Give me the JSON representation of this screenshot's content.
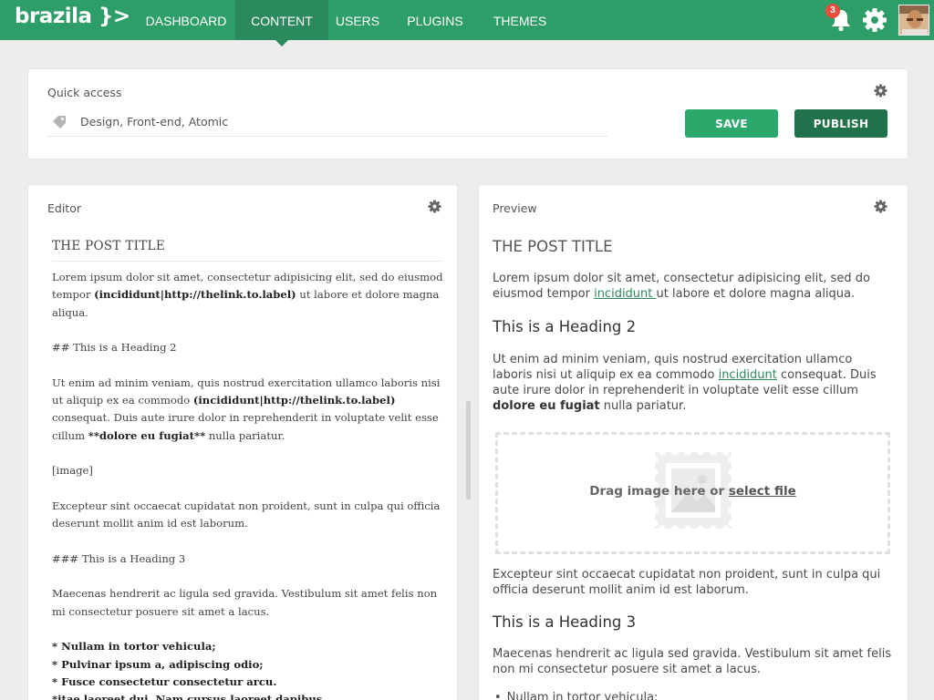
{
  "nav": {
    "logo": "brazila }>",
    "items": [
      {
        "label": "DASHBOARD"
      },
      {
        "label": "CONTENT"
      },
      {
        "label": "USERS"
      },
      {
        "label": "PLUGINS"
      },
      {
        "label": "THEMES"
      }
    ],
    "active_item": "CONTENT",
    "notifications": "3"
  },
  "quick_access": {
    "label": "Quick access",
    "tags_value": "Design, Front-end, Atomic",
    "save_label": "SAVE",
    "publish_label": "PUBLISH"
  },
  "editor": {
    "label": "Editor",
    "title": "THE POST TITLE",
    "p1_a": "Lorem ipsum dolor sit amet, consectetur adipisicing elit, sed do eiusmod tempor ",
    "p1_bold": "(incididunt|http://thelink.to.label)",
    "p1_b": " ut labore et dolore magna aliqua.",
    "h2": "## This is a Heading 2",
    "p2_a": "Ut enim ad minim veniam, quis nostrud exercitation ullamco laboris nisi ut aliquip ex ea commodo ",
    "p2_bold": "(incididunt|http://thelink.to.label)",
    "p2_b": " consequat. Duis aute irure dolor in reprehenderit in voluptate velit esse cillum ",
    "p2_bold2": "**dolore eu fugiat**",
    "p2_c": " nulla pariatur.",
    "image": "[image]",
    "p3": "Excepteur sint occaecat cupidatat non proident, sunt in culpa qui officia deserunt mollit anim id est laborum.",
    "h3": "### This is a Heading 3",
    "p4": "Maecenas hendrerit ac ligula sed gravida. Vestibulum sit amet felis non mi consectetur posuere sit amet a lacus.",
    "list": [
      "* Nullam in tortor vehicula;",
      "* Pulvinar ipsum a, adipiscing odio;",
      "* Fusce consectetur consectetur arcu.",
      "*itae laoreet dui. Nam cursus laoreet dapibus."
    ]
  },
  "preview": {
    "label": "Preview",
    "title": "THE POST TITLE",
    "p1_a": "Lorem ipsum dolor sit amet, consectetur adipisicing elit, sed do eiusmod tempor ",
    "p1_link": "incididunt ",
    "p1_b": "ut labore et dolore magna aliqua.",
    "h2": "This is a Heading 2",
    "p2_a": "Ut enim ad minim veniam, quis nostrud exercitation ullamco laboris nisi ut aliquip ex ea commodo ",
    "p2_link": "incididunt",
    "p2_b": " consequat. Duis aute irure dolor in reprehenderit in voluptate velit esse cillum ",
    "p2_bold": "dolore eu fugiat",
    "p2_c": " nulla pariatur.",
    "drop_text": "Drag image here or ",
    "drop_link": "select file",
    "p3": "Excepteur sint occaecat cupidatat non proident, sunt in culpa qui officia deserunt mollit anim id est laborum.",
    "h3": "This is a Heading 3",
    "p4": "Maecenas hendrerit ac ligula sed gravida. Vestibulum sit amet felis non mi consectetur posuere sit amet a lacus.",
    "list": [
      "Nullam in tortor vehicula;"
    ]
  },
  "colors": {
    "brand": "#2e9e68",
    "nav_active": "#2a8a5b",
    "save": "#2ca86c",
    "publish": "#20724a",
    "badge": "#e74c3c",
    "link": "#2e8a5b"
  },
  "icons": [
    "bell-icon",
    "gear-icon",
    "tag-icon",
    "image-placeholder-icon",
    "avatar"
  ]
}
